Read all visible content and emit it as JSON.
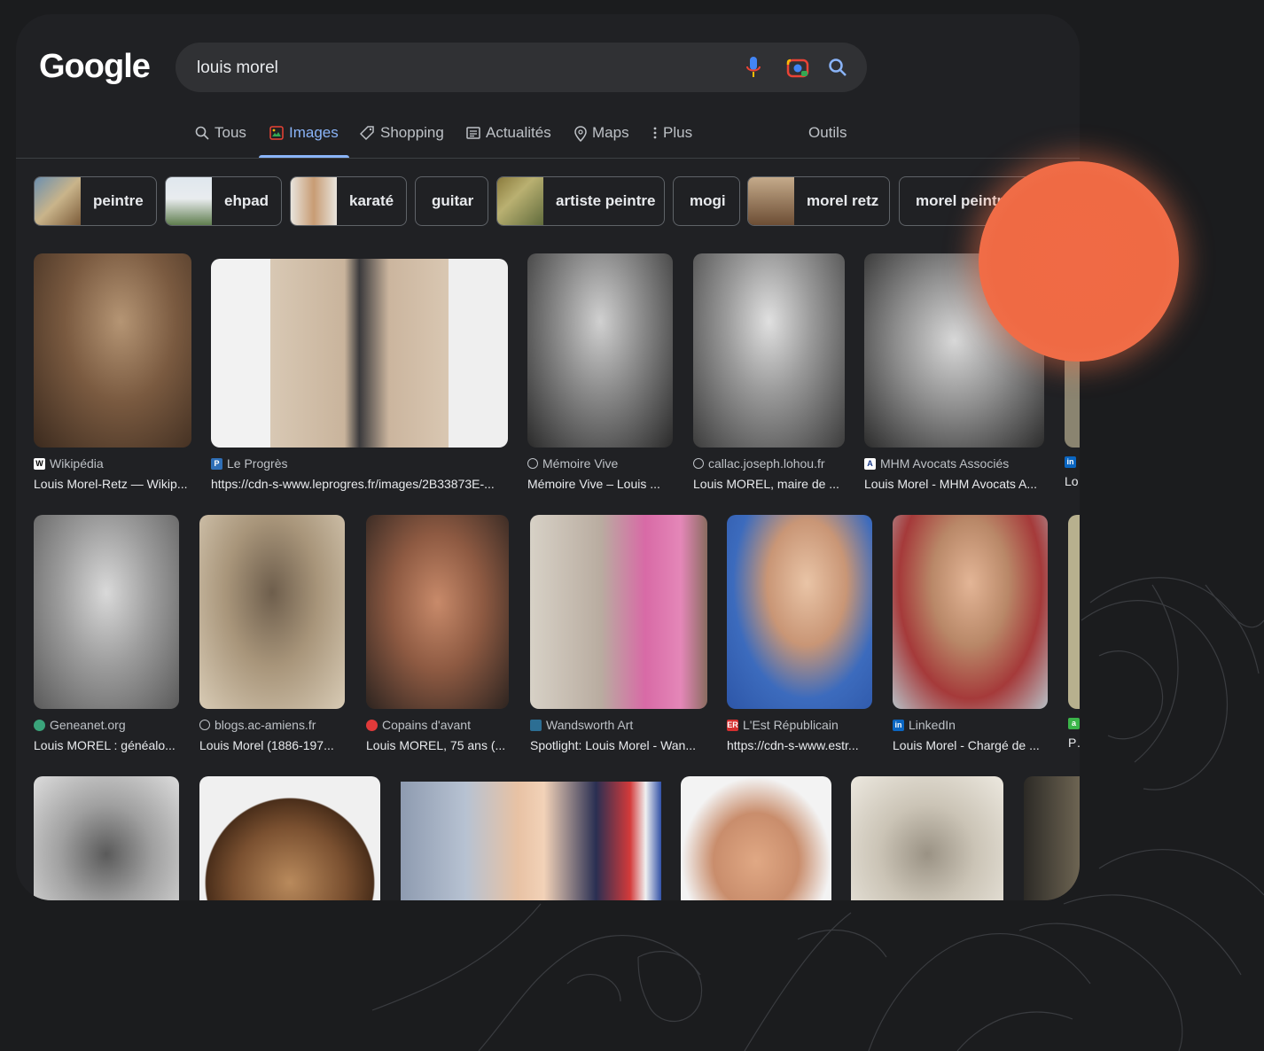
{
  "logo": "Google",
  "search": {
    "query": "louis morel"
  },
  "tabs": [
    {
      "label": "Tous"
    },
    {
      "label": "Images"
    },
    {
      "label": "Shopping"
    },
    {
      "label": "Actualités"
    },
    {
      "label": "Maps"
    },
    {
      "label": "Plus"
    }
  ],
  "tools_label": "Outils",
  "chips": [
    "peintre",
    "ehpad",
    "karaté",
    "guitar",
    "artiste peintre",
    "mogi",
    "morel retz",
    "morel peintre"
  ],
  "results": [
    {
      "source": "Wikipédia",
      "title": "Louis Morel-Retz — Wikip..."
    },
    {
      "source": "Le Progrès",
      "title": "https://cdn-s-www.leprogres.fr/images/2B33873E-..."
    },
    {
      "source": "Mémoire Vive",
      "title": "Mémoire Vive – Louis ..."
    },
    {
      "source": "callac.joseph.lohou.fr",
      "title": "Louis MOREL, maire de ..."
    },
    {
      "source": "MHM Avocats Associés",
      "title": "Louis Morel - MHM Avocats A..."
    },
    {
      "source": "Geneanet.org",
      "title": "Louis MOREL : généalo..."
    },
    {
      "source": "blogs.ac-amiens.fr",
      "title": "Louis Morel (1886-197..."
    },
    {
      "source": "Copains d'avant",
      "title": "Louis MOREL, 75 ans (..."
    },
    {
      "source": "Wandsworth Art",
      "title": "Spotlight: Louis Morel - Wan..."
    },
    {
      "source": "L'Est Républicain",
      "title": "https://cdn-s-www.estr..."
    },
    {
      "source": "LinkedIn",
      "title": "Louis Morel - Chargé de ..."
    }
  ],
  "partial_titles": {
    "row1": "Lo",
    "row2": "Po"
  },
  "colors": {
    "accent": "#8ab4f8",
    "background": "#202124",
    "cursor_dot": "#ef6a44"
  }
}
